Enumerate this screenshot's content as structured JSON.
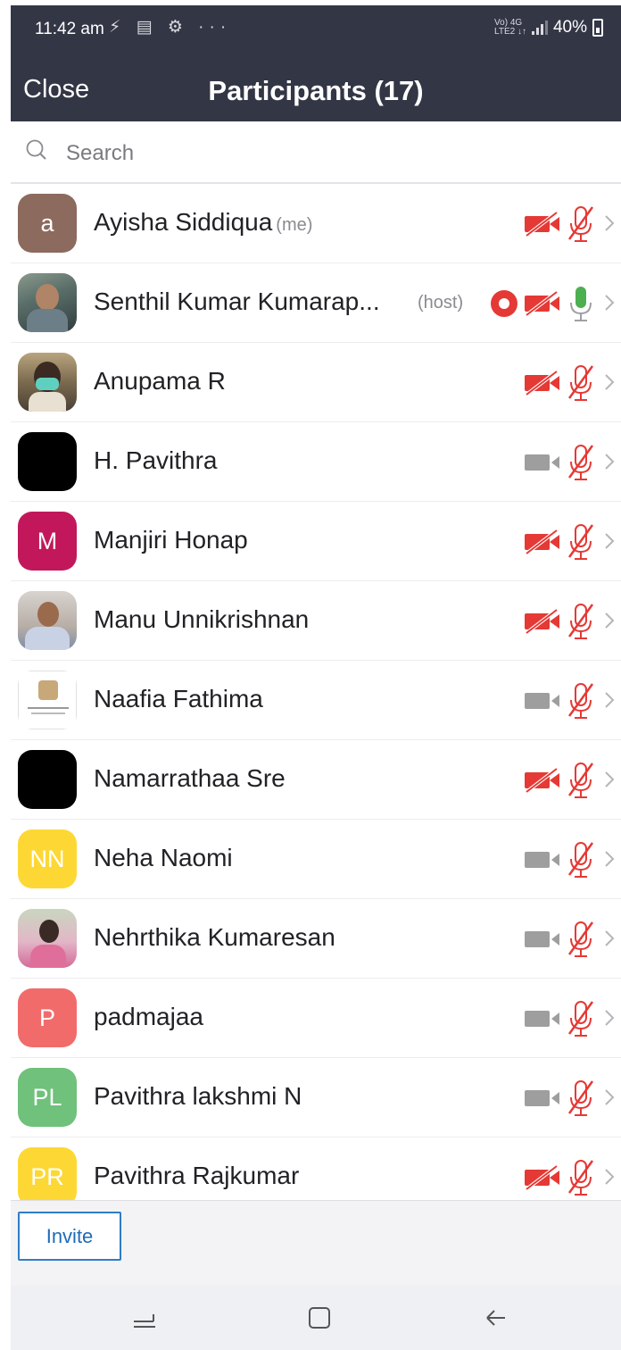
{
  "status_bar": {
    "time": "11:42 am",
    "extra_icons": "⚡ ▤ ⚙ ···",
    "network_top": "Vo) 4G",
    "network_bottom": "LTE2 ↓↑",
    "battery": "40%"
  },
  "header": {
    "close_label": "Close",
    "title": "Participants (17)"
  },
  "search": {
    "placeholder": "Search"
  },
  "participants": [
    {
      "name": "Ayisha Siddiqua",
      "tag": "(me)",
      "avatar_text": "a",
      "avatar_color": "#8c6a5d",
      "video": "off",
      "audio": "muted"
    },
    {
      "name": "Senthil Kumar Kumarap...",
      "tag": "(host)",
      "avatar_text": "",
      "avatar_color": "photo",
      "video": "off",
      "audio": "on",
      "recording": true
    },
    {
      "name": "Anupama R",
      "tag": "",
      "avatar_text": "",
      "avatar_color": "photo",
      "video": "off",
      "audio": "muted"
    },
    {
      "name": "H. Pavithra",
      "tag": "",
      "avatar_text": "",
      "avatar_color": "#000000",
      "video": "available",
      "audio": "muted"
    },
    {
      "name": "Manjiri Honap",
      "tag": "",
      "avatar_text": "M",
      "avatar_color": "#c2185b",
      "video": "off",
      "audio": "muted"
    },
    {
      "name": "Manu Unnikrishnan",
      "tag": "",
      "avatar_text": "",
      "avatar_color": "photo",
      "video": "off",
      "audio": "muted"
    },
    {
      "name": "Naafia Fathima",
      "tag": "",
      "avatar_text": "",
      "avatar_color": "photo",
      "video": "available",
      "audio": "muted"
    },
    {
      "name": "Namarrathaa Sre",
      "tag": "",
      "avatar_text": "",
      "avatar_color": "#000000",
      "video": "off",
      "audio": "muted"
    },
    {
      "name": "Neha Naomi",
      "tag": "",
      "avatar_text": "NN",
      "avatar_color": "#fdd835",
      "video": "available",
      "audio": "muted"
    },
    {
      "name": "Nehrthika Kumaresan",
      "tag": "",
      "avatar_text": "",
      "avatar_color": "photo",
      "video": "available",
      "audio": "muted"
    },
    {
      "name": "padmajaa",
      "tag": "",
      "avatar_text": "P",
      "avatar_color": "#f26b6b",
      "video": "available",
      "audio": "muted"
    },
    {
      "name": "Pavithra lakshmi N",
      "tag": "",
      "avatar_text": "PL",
      "avatar_color": "#6fc17b",
      "video": "available",
      "audio": "muted"
    },
    {
      "name": "Pavithra Rajkumar",
      "tag": "",
      "avatar_text": "PR",
      "avatar_color": "#fdd835",
      "video": "off",
      "audio": "muted"
    }
  ],
  "footer": {
    "invite_label": "Invite"
  },
  "colors": {
    "header_bg": "#333645",
    "muted_red": "#e53935",
    "mic_green": "#4caf50",
    "video_gray": "#9e9e9e",
    "invite_blue": "#2e7cc6"
  }
}
